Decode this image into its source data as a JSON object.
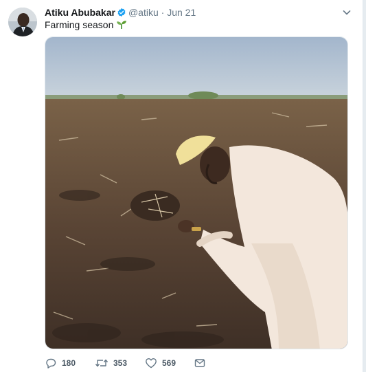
{
  "tweet": {
    "author_name": "Atiku Abubakar",
    "handle": "@atiku",
    "separator": "·",
    "date": "Jun 21",
    "text": "Farming season",
    "emoji_icon": "seedling-icon"
  },
  "actions": {
    "replies": "180",
    "retweets": "353",
    "likes": "569"
  },
  "colors": {
    "verified": "#1da1f2",
    "secondary_text": "#657786",
    "sky": "#aebfd1",
    "soil": "#5a4535"
  }
}
